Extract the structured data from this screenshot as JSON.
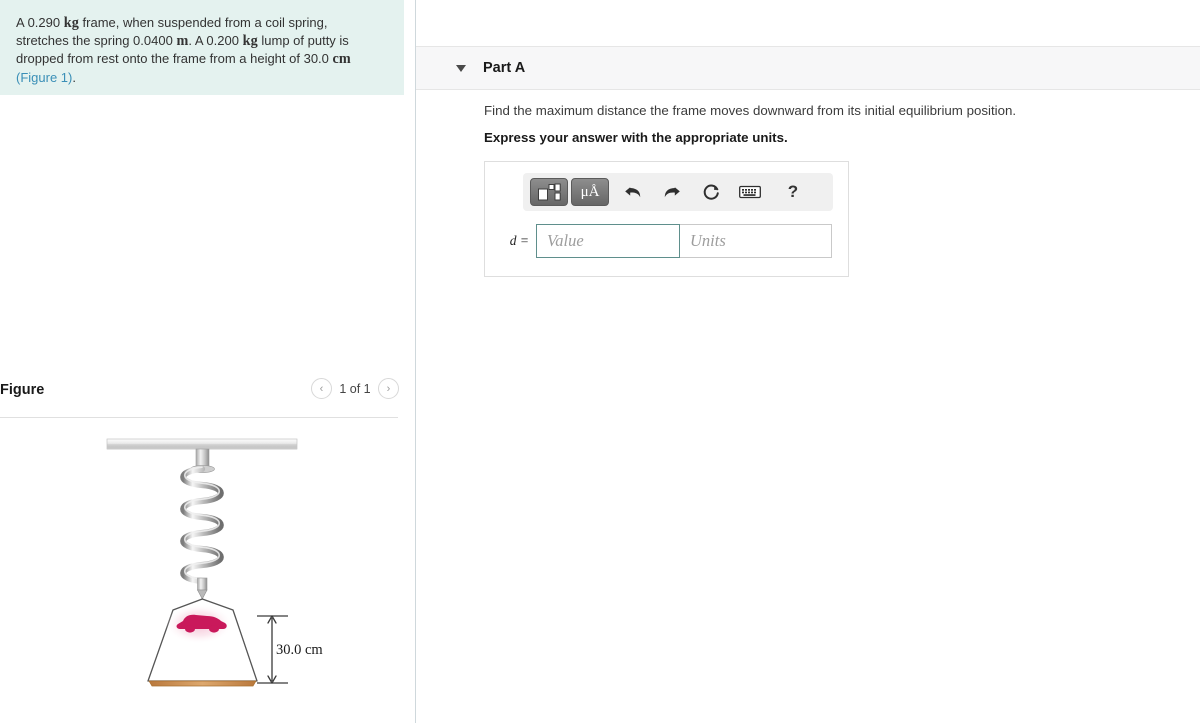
{
  "problem": {
    "text_parts": [
      "A 0.290 ",
      "kg",
      " frame, when suspended from a coil spring, stretches the spring 0.0400 ",
      "m",
      ". A 0.200 ",
      "kg",
      " lump of putty is dropped from rest onto the frame from a height of 30.0 ",
      "cm",
      " "
    ],
    "full_text": "A 0.290 kg frame, when suspended from a coil spring, stretches the spring 0.0400 m. A 0.200 kg lump of putty is dropped from rest onto the frame from a height of 30.0 cm (Figure 1).",
    "figure_link": "(Figure 1)",
    "background_color": "#e4f2ef",
    "link_color": "#3a8fb7"
  },
  "figure": {
    "title": "Figure",
    "counter": "1 of 1",
    "prev_label": "‹",
    "next_label": "›",
    "diagram": {
      "dimension_label": "30.0 cm",
      "putty_color": "#c9195b",
      "base_color": "#c98a4b",
      "spring_color": "#8f8f8f",
      "ceiling_color": "#d9d9d9"
    }
  },
  "part": {
    "label": "Part A",
    "question": "Find the maximum distance the frame moves downward from its initial equilibrium position.",
    "instruction": "Express your answer with the appropriate units.",
    "collapse_icon": "chevron-down"
  },
  "answer": {
    "variable_label": "d =",
    "value_placeholder": "Value",
    "units_placeholder": "Units",
    "value": "",
    "units": "",
    "toolbar": {
      "template_label": "",
      "units_label": "μÅ",
      "undo_label": "↩",
      "redo_label": "↪",
      "reset_label": "⟳",
      "keyboard_label": "⌨",
      "help_label": "?"
    }
  }
}
